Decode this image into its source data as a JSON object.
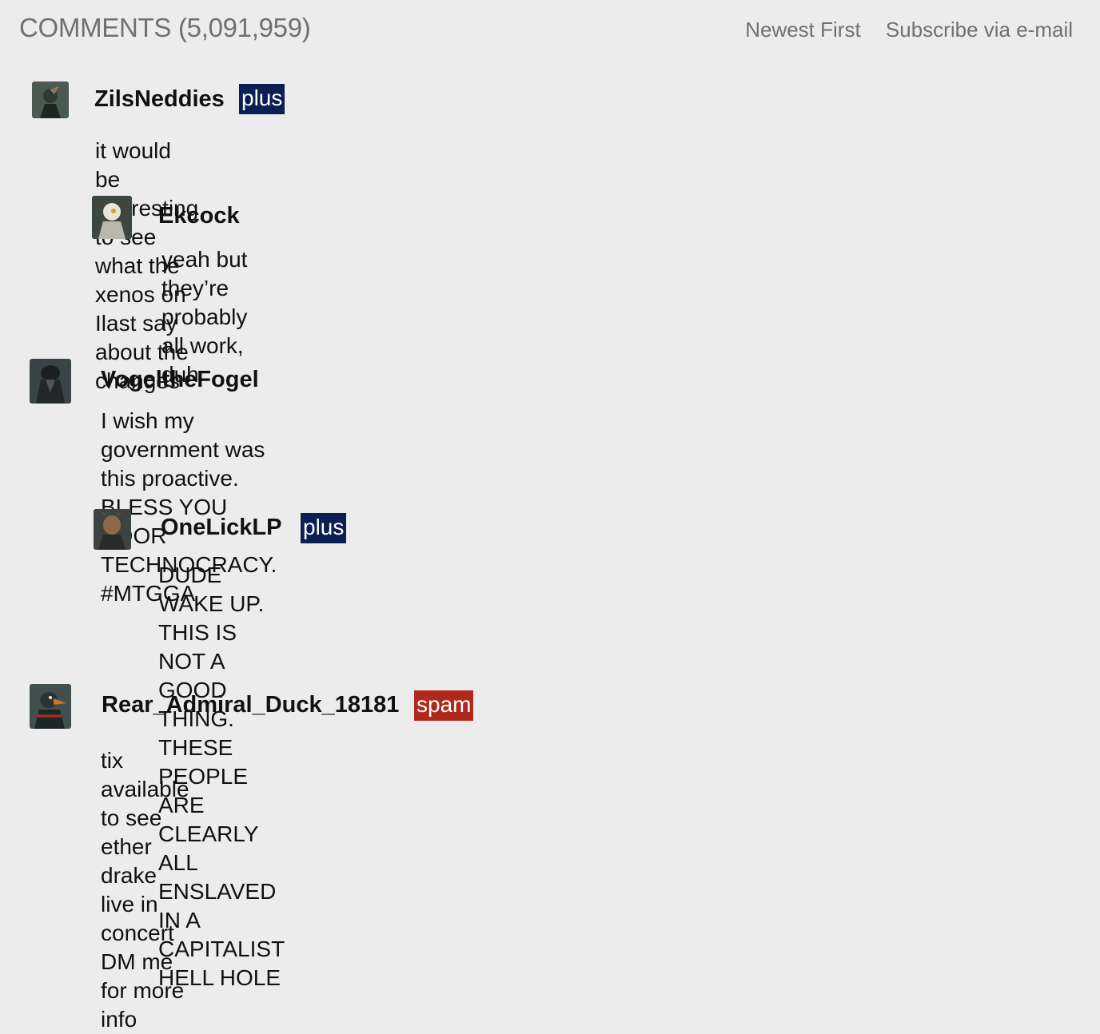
{
  "header": {
    "title": "COMMENTS (5,091,959)",
    "sort_label": "Newest First",
    "subscribe_label": "Subscribe via e-mail"
  },
  "comments": [
    {
      "user": "ZilsNeddies",
      "badge": "plus",
      "text": "it would be interesting to see what the xenos on Ilast say about the changes",
      "avatar_color": "#3b4a43"
    },
    {
      "user": "Ekcock",
      "badge": "",
      "text": "yeah but they’re probably all work, duh",
      "avatar_color": "#8c8f84"
    },
    {
      "user": "VogeltheFogel",
      "badge": "",
      "text": "I wish my government was this proactive. BLESS YOU VOOR TECHNOCRACY.\n#MTGGA",
      "avatar_color": "#2c3333"
    },
    {
      "user": "OneLickLP",
      "badge": "plus",
      "text": "DUDE WAKE UP. THIS IS NOT A GOOD THING.\nTHESE PEOPLE ARE CLEARLY ALL ENSLAVED IN A CAPITALIST HELL HOLE",
      "avatar_color": "#5a4a3a"
    },
    {
      "user": "Rear_Admiral_Duck_18181",
      "badge": "spam",
      "text": "tix available to see ether drake live in concert\nDM me for more info",
      "avatar_color": "#3d4a4d"
    }
  ],
  "colors": {
    "plus_badge": "#0c1f52",
    "spam_badge": "#b0291c",
    "background": "#ececec"
  }
}
